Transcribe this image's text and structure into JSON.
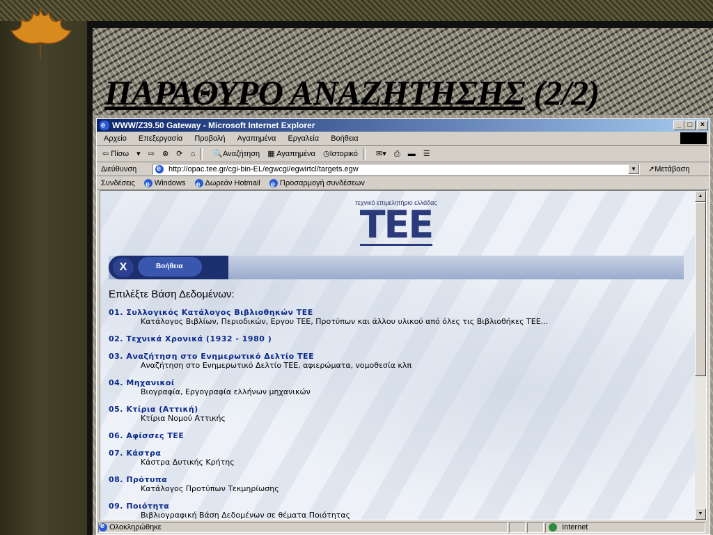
{
  "slide": {
    "title_main": "ΠΑΡΑΘΥΡΟ ΑΝΑΖΗΤΗΣΗΣ",
    "title_suffix": " (2/2)"
  },
  "window": {
    "title": "WWW/Z39.50 Gateway - Microsoft Internet Explorer",
    "minimize": "_",
    "maximize": "□",
    "close": "×"
  },
  "menu": [
    "Αρχείο",
    "Επεξεργασία",
    "Προβολή",
    "Αγαπημένα",
    "Εργαλεία",
    "Βοήθεια"
  ],
  "toolbar": {
    "back": "⇦ Πίσω",
    "forward": "⇨",
    "search": "Αναζήτηση",
    "favorites": "Αγαπημένα",
    "history": "Ιστορικό"
  },
  "address": {
    "label": "Διεύθυνση",
    "url": "http://opac.tee.gr/cgi-bin-EL/egwcgi/egwirtcl/targets.egw",
    "go": "Μετάβαση"
  },
  "links": {
    "label": "Συνδέσεις",
    "items": [
      "Windows",
      "Δωρεάν Hotmail",
      "Προσαρμογή συνδέσεων"
    ]
  },
  "page": {
    "logo_tagline": "τεχνικό επιμελητήριο ελλάδας",
    "logo_mark": "ΤΕΕ",
    "close_icon_text": "X",
    "help_label": "Βοήθεια",
    "heading": "Επιλέξτε Βάση Δεδομένων:",
    "databases": [
      {
        "title": "01. Συλλογικός Κατάλογος Βιβλιοθηκών ΤΕΕ",
        "desc": "Κατάλογος Βιβλίων, Περιοδικών, Εργου ΤΕΕ, Προτύπων και άλλου υλικού από όλες τις Βιβλιοθήκες ΤΕΕ..."
      },
      {
        "title": "02. Τεχνικά Χρονικά (1932 - 1980 )",
        "desc": ""
      },
      {
        "title": "03. Αναζήτηση στο Ενημερωτικό Δελτίο ΤΕΕ",
        "desc": "Αναζήτηση στο Ενημερωτικό Δελτίο ΤΕΕ, αφιερώματα, νομοθεσία κλπ"
      },
      {
        "title": "04. Μηχανικοί",
        "desc": "Βιογραφία, Εργογραφία ελλήνων μηχανικών"
      },
      {
        "title": "05. Κτίρια (Αττική)",
        "desc": "Κτίρια Νομού Αττικής"
      },
      {
        "title": "06. Αφίσσες ΤΕΕ",
        "desc": ""
      },
      {
        "title": "07. Κάστρα",
        "desc": "Κάστρα Δυτικής Κρήτης"
      },
      {
        "title": "08. Πρότυπα",
        "desc": "Κατάλογος Προτύπων Τεκμηρίωσης"
      },
      {
        "title": "09. Ποιότητα",
        "desc": "Βιβλιογραφική Βάση Δεδομένων σε θέματα Ποιότητας"
      }
    ]
  },
  "status": {
    "text": "Ολοκληρώθηκε",
    "zone": "Internet"
  }
}
